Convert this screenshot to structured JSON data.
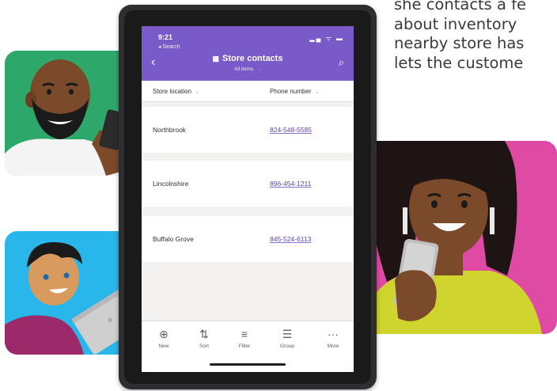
{
  "caption": {
    "lines": [
      "she contacts a fe",
      "about inventory",
      "nearby store has",
      "lets the custome"
    ]
  },
  "status_bar": {
    "time": "9:21",
    "back_label": "◂ Search",
    "icons": "▂▄ ᯤ ▬"
  },
  "header": {
    "title": "Store contacts",
    "view": "All items",
    "back_icon": "‹",
    "search_icon": "⌕",
    "list_icon": "▦"
  },
  "columns": {
    "location": "Store location",
    "phone": "Phone number",
    "chevron": "⌄"
  },
  "rows": [
    {
      "location": "Northbrook",
      "phone": "824-548-5585"
    },
    {
      "location": "Lincolnshire",
      "phone": "896-454-1211"
    },
    {
      "location": "Buffalo Grove",
      "phone": "845-524-6113"
    }
  ],
  "toolbar": {
    "new": {
      "icon": "⊕",
      "label": "New"
    },
    "sort": {
      "icon": "⇅",
      "label": "Sort"
    },
    "filter": {
      "icon": "≡",
      "label": "Filter"
    },
    "group": {
      "icon": "☰",
      "label": "Group"
    },
    "more": {
      "icon": "···",
      "label": "More"
    }
  },
  "colors": {
    "header": "#7a5ac9",
    "link": "#5c3fae",
    "card_green": "#2ea86a",
    "card_blue": "#29b6ea",
    "card_pink": "#df4aa4"
  }
}
